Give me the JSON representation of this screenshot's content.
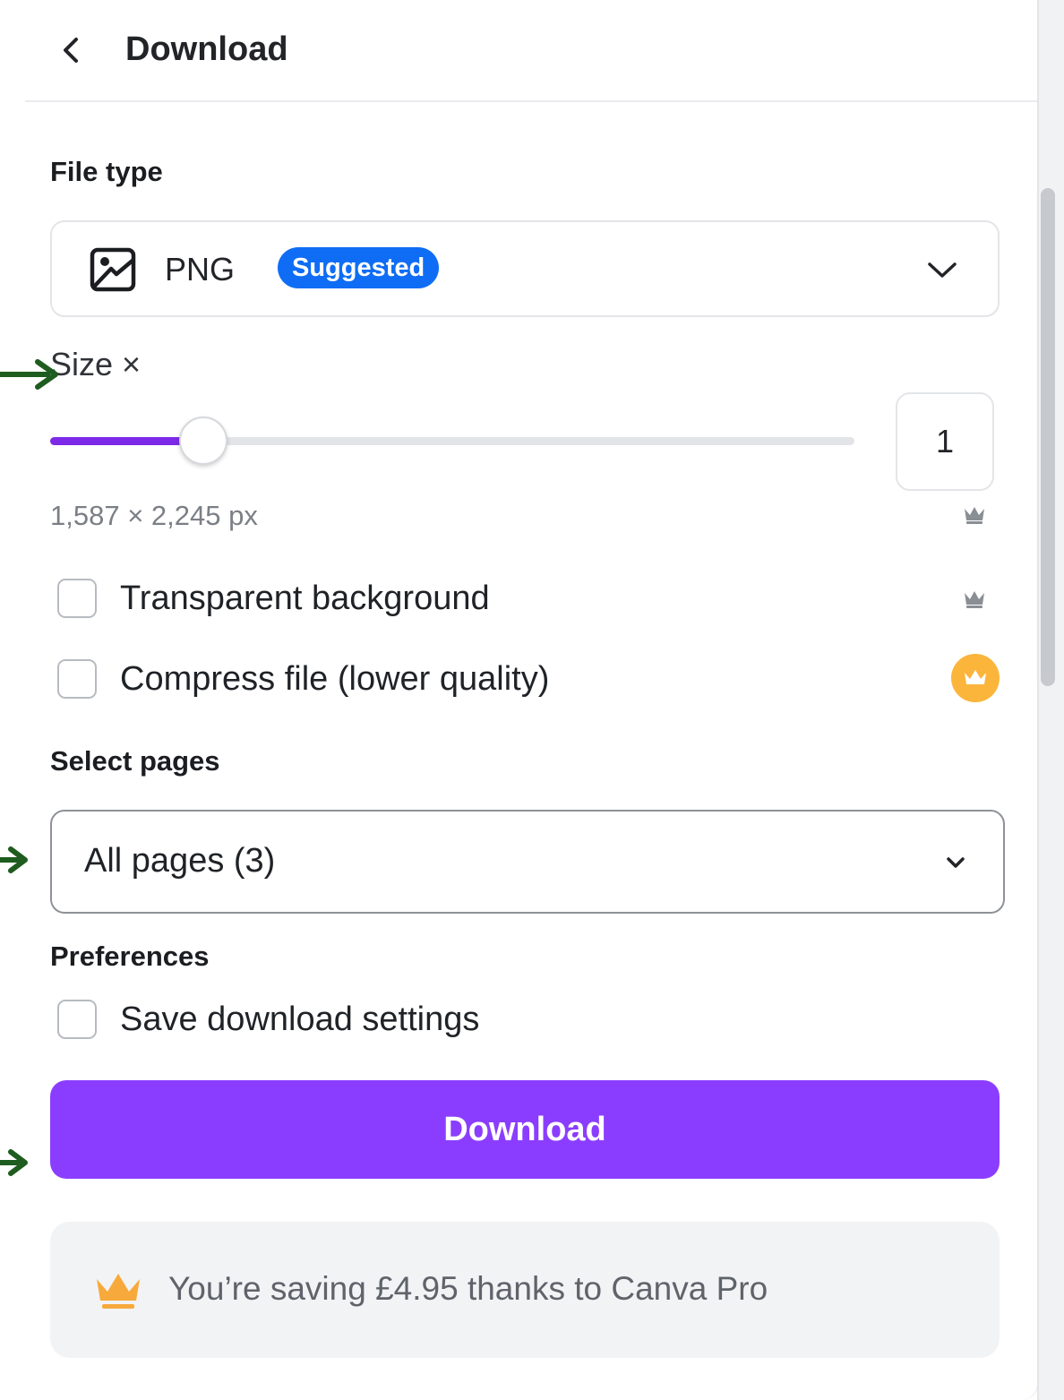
{
  "header": {
    "title": "Download",
    "back_icon": "chevron-left-icon"
  },
  "file_type": {
    "label": "File type",
    "value": "PNG",
    "icon": "image-icon",
    "badge": "Suggested",
    "expand_icon": "chevron-down-icon"
  },
  "size": {
    "label": "Size ×",
    "slider_fraction": 0.19,
    "value": "1",
    "dimensions": "1,587 × 2,245 px",
    "pro_icon": "crown-icon"
  },
  "options": {
    "transparent": {
      "label": "Transparent background",
      "checked": false
    },
    "compress": {
      "label": "Compress file (lower quality)",
      "checked": false
    }
  },
  "pages": {
    "label": "Select pages",
    "value": "All pages (3)",
    "expand_icon": "chevron-down-icon"
  },
  "preferences": {
    "label": "Preferences",
    "save_settings": {
      "label": "Save download settings",
      "checked": false
    }
  },
  "download_button": {
    "label": "Download"
  },
  "savings": {
    "text": "You’re saving £4.95 thanks to Canva Pro",
    "icon": "crown-icon"
  },
  "colors": {
    "accent": "#8b3dff",
    "badge": "#0f6df5",
    "crown": "#fbb53b",
    "annotation_arrow": "#1f5c1f"
  }
}
